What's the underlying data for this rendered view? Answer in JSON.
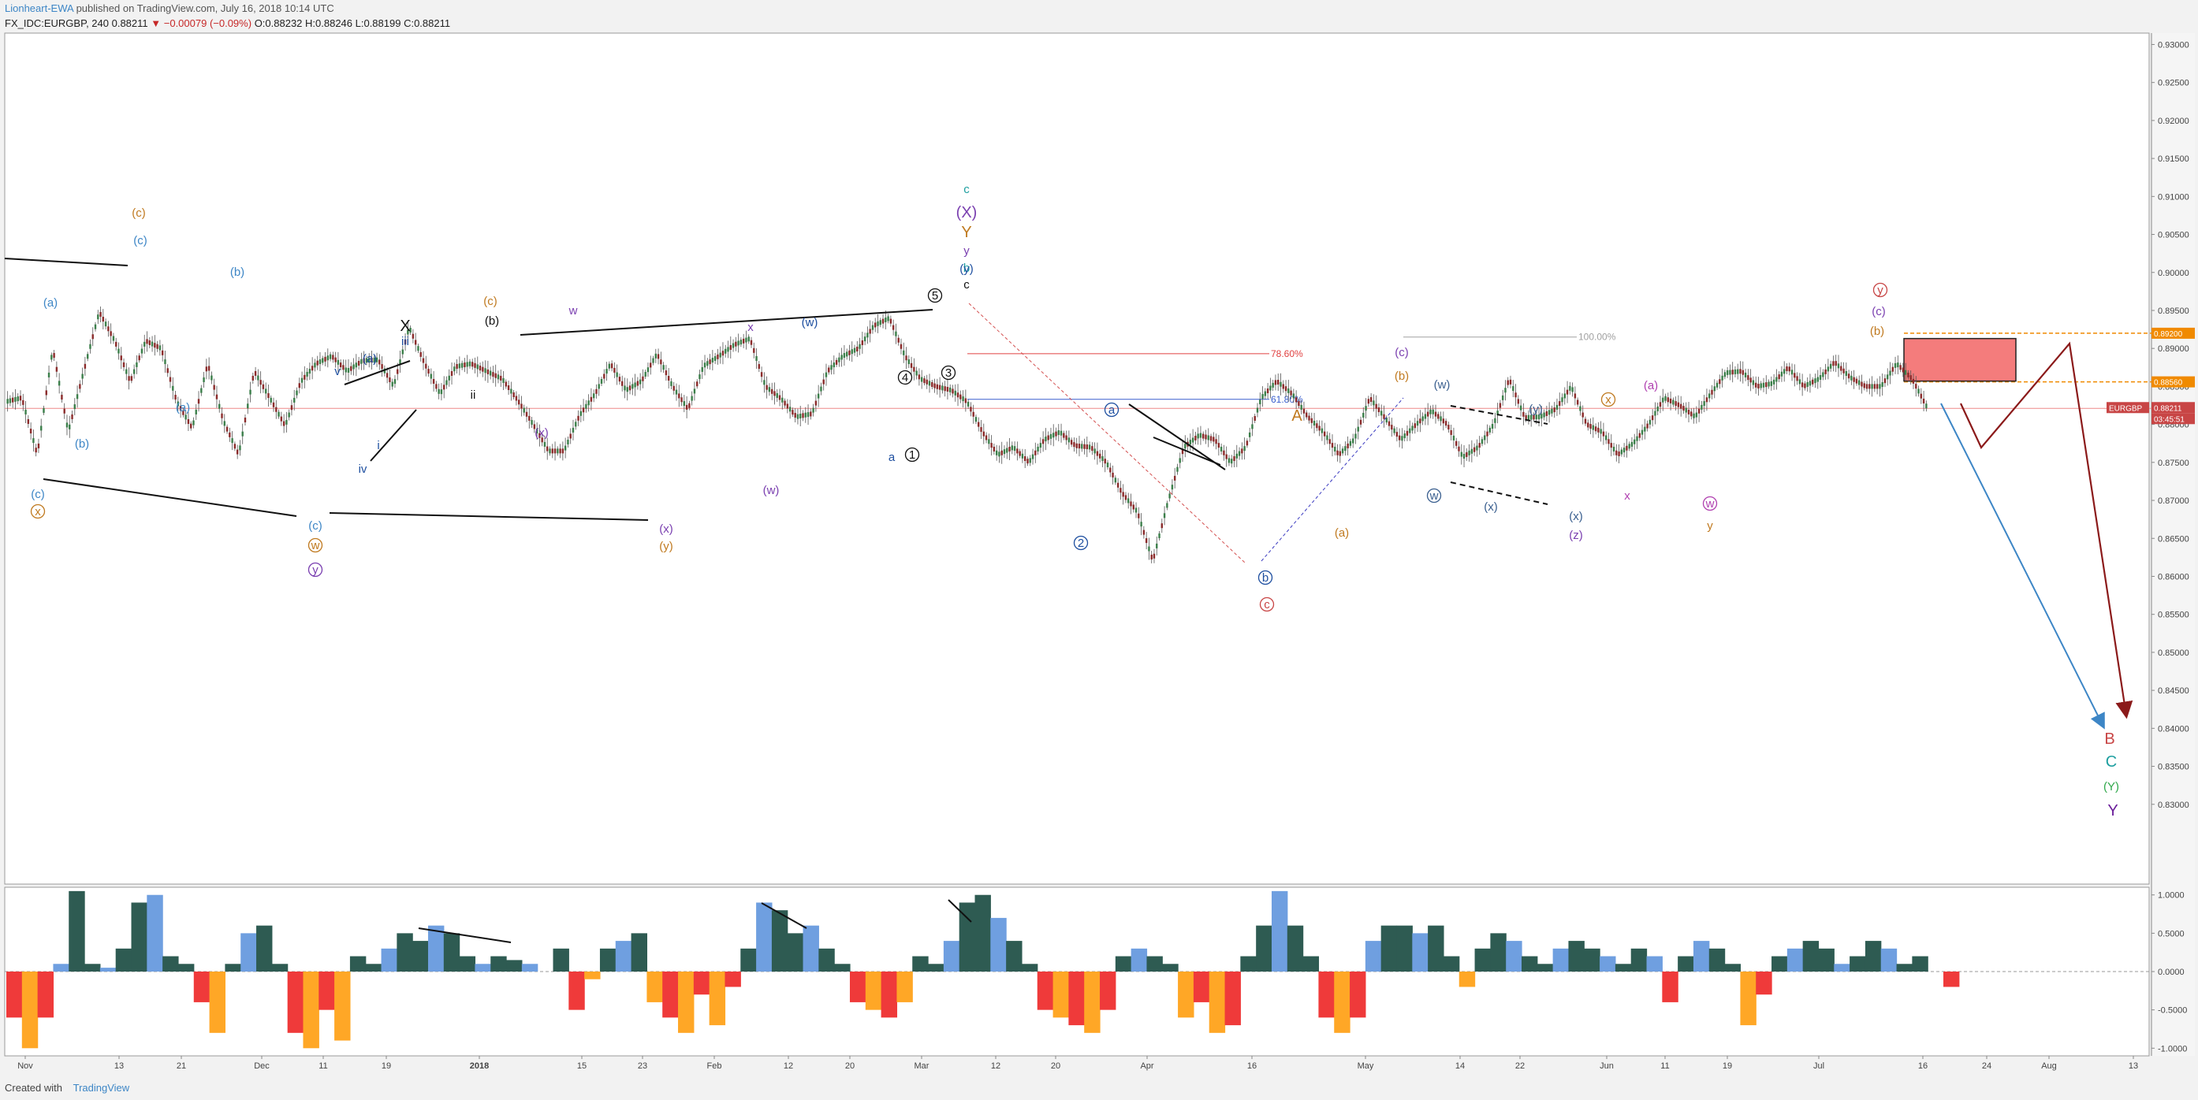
{
  "header": {
    "author": "Lionheart-EWA",
    "published": "published on TradingView.com, July 16, 2018 10:14 UTC",
    "symbol": "FX_IDC:EURGBP, 240",
    "last": "0.88211",
    "change": "▼ −0.00079 (−0.09%)",
    "ohlc": "O:0.88232 H:0.88246 L:0.88199 C:0.88211"
  },
  "footer": {
    "created_with": "Created with",
    "brand": "TradingView"
  },
  "chart_data": [
    {
      "type": "line",
      "title": "",
      "symbol": "EURGBP",
      "ylim": [
        0.8195,
        0.9315
      ],
      "y_ticks": [
        "0.83000",
        "0.83500",
        "0.84000",
        "0.84500",
        "0.85000",
        "0.85500",
        "0.86000",
        "0.86500",
        "0.87000",
        "0.87500",
        "0.88000",
        "0.88500",
        "0.89000",
        "0.89500",
        "0.90000",
        "0.90500",
        "0.91000",
        "0.91500",
        "0.92000",
        "0.92500",
        "0.93000"
      ],
      "x_ticks": [
        "Nov",
        "13",
        "21",
        "Dec",
        "11",
        "19",
        "2018",
        "15",
        "23",
        "Feb",
        "12",
        "20",
        "Mar",
        "12",
        "20",
        "Apr",
        "16",
        "May",
        "14",
        "22",
        "Jun",
        "11",
        "19",
        "Jul",
        "16",
        "24",
        "Aug",
        "13"
      ],
      "price_labels": [
        {
          "text": "EURGBP",
          "color": "#c84545"
        },
        {
          "text": "0.88211",
          "color": "#c84545"
        },
        {
          "text": "03:45:51",
          "color": "#c84545"
        },
        {
          "text": "0.89200",
          "color": "#f08a00"
        },
        {
          "text": "0.88560",
          "color": "#f08a00"
        }
      ],
      "fib_levels": [
        {
          "label": "100.00%",
          "value": 0.8915,
          "color": "#a0a0a0"
        },
        {
          "label": "78.60%",
          "value": 0.8893,
          "color": "#e04040"
        },
        {
          "label": "61.80%",
          "value": 0.8833,
          "color": "#3a5fcd"
        }
      ],
      "series": [
        {
          "values": [
            0.883,
            0.8835,
            0.876,
            0.89,
            0.879,
            0.887,
            0.8948,
            0.891,
            0.8856,
            0.891,
            0.89,
            0.883,
            0.8795,
            0.888,
            0.8805,
            0.876,
            0.887,
            0.8835,
            0.8798,
            0.8856,
            0.888,
            0.889,
            0.887,
            0.8884,
            0.8885,
            0.885,
            0.8928,
            0.888,
            0.884,
            0.8876,
            0.888,
            0.887,
            0.886,
            0.8832,
            0.88,
            0.8765,
            0.8765,
            0.8812,
            0.884,
            0.888,
            0.8845,
            0.8857,
            0.8893,
            0.885,
            0.882,
            0.8877,
            0.889,
            0.8905,
            0.8913,
            0.885,
            0.8834,
            0.881,
            0.8814,
            0.887,
            0.889,
            0.89,
            0.893,
            0.894,
            0.889,
            0.886,
            0.885,
            0.8845,
            0.883,
            0.879,
            0.876,
            0.877,
            0.875,
            0.878,
            0.879,
            0.8772,
            0.877,
            0.875,
            0.871,
            0.8685,
            0.862,
            0.87,
            0.877,
            0.8786,
            0.878,
            0.875,
            0.877,
            0.8835,
            0.8857,
            0.884,
            0.881,
            0.879,
            0.876,
            0.878,
            0.8835,
            0.8808,
            0.878,
            0.88,
            0.8818,
            0.88,
            0.8757,
            0.877,
            0.88,
            0.886,
            0.8809,
            0.881,
            0.882,
            0.885,
            0.88,
            0.879,
            0.876,
            0.8775,
            0.88,
            0.8835,
            0.8825,
            0.881,
            0.884,
            0.8868,
            0.887,
            0.885,
            0.8854,
            0.8875,
            0.885,
            0.886,
            0.8882,
            0.8862,
            0.885,
            0.885,
            0.888,
            0.886,
            0.8821
          ]
        }
      ],
      "forecast": [
        {
          "color": "#3d86c6",
          "style": "arrow"
        },
        {
          "color": "#8b1a1a",
          "style": "arrow"
        }
      ],
      "wave_labels": [
        "(c)",
        "(a)",
        "(b)",
        "(c)",
        "(a)",
        "(b)",
        "(c)",
        "(c)",
        "x",
        "w",
        "y",
        "X",
        "(a)",
        "iii",
        "v",
        "i",
        "iv",
        "ii",
        "(b)",
        "(c)",
        "w",
        "(x)",
        "(w)",
        "(x)",
        "(y)",
        "x",
        "(w)",
        "a",
        "b",
        "c",
        "(X)",
        "Y",
        "y",
        "(y)",
        "c",
        "5",
        "3",
        "4",
        "1",
        "2",
        "a",
        "b",
        "c",
        "A",
        "(a)",
        "(b)",
        "(c)",
        "w",
        "(w)",
        "(x)",
        "(y)",
        "(x)",
        "(z)",
        "x",
        "(a)",
        "x",
        "w",
        "y",
        "(b)",
        "(c)",
        "y",
        "B",
        "C",
        "(Y)",
        "Y",
        "b"
      ]
    },
    {
      "type": "area",
      "title": "",
      "ylim": [
        -1.1,
        1.1
      ],
      "y_ticks": [
        "1.0000",
        "0.5000",
        "0.0000",
        "-0.5000",
        "-1.0000"
      ],
      "series": [
        {
          "values": [
            -0.6,
            -1.0,
            -0.6,
            0.1,
            1.05,
            0.1,
            0.05,
            0.3,
            0.9,
            1.0,
            0.2,
            0.1,
            -0.4,
            -0.8,
            0.1,
            0.5,
            0.6,
            0.1,
            -0.8,
            -1.0,
            -0.5,
            -0.9,
            0.2,
            0.1,
            0.3,
            0.5,
            0.4,
            0.6,
            0.5,
            0.2,
            0.1,
            0.2,
            0.15,
            0.1,
            0.0,
            0.3,
            -0.5,
            -0.1,
            0.3,
            0.4,
            0.5,
            -0.4,
            -0.6,
            -0.8,
            -0.3,
            -0.7,
            -0.2,
            0.3,
            0.9,
            0.8,
            0.5,
            0.6,
            0.3,
            0.1,
            -0.4,
            -0.5,
            -0.6,
            -0.4,
            0.2,
            0.1,
            0.4,
            0.9,
            1.0,
            0.7,
            0.4,
            0.1,
            -0.5,
            -0.6,
            -0.7,
            -0.8,
            -0.5,
            0.2,
            0.3,
            0.2,
            0.1,
            -0.6,
            -0.4,
            -0.8,
            -0.7,
            0.2,
            0.6,
            1.05,
            0.6,
            0.2,
            -0.6,
            -0.8,
            -0.6,
            0.4,
            0.6,
            0.6,
            0.5,
            0.6,
            0.2,
            -0.2,
            0.3,
            0.5,
            0.4,
            0.2,
            0.1,
            0.3,
            0.4,
            0.3,
            0.2,
            0.1,
            0.3,
            0.2,
            -0.4,
            0.2,
            0.4,
            0.3,
            0.1,
            -0.7,
            -0.3,
            0.2,
            0.3,
            0.4,
            0.3,
            0.1,
            0.2,
            0.4,
            0.3,
            0.1,
            0.2,
            0.0,
            -0.2
          ]
        }
      ],
      "colors": {
        "pos_dark": "#2e5b52",
        "pos_light": "#6f9fe0",
        "neg_red": "#ef3a3a",
        "neg_orange": "#ffa726"
      }
    }
  ]
}
